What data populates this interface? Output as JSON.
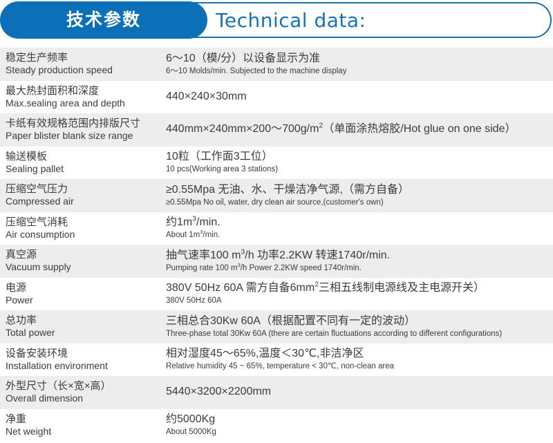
{
  "header": {
    "pill_label": "技术参数",
    "title": "Technical data:",
    "pill_color": "#0b70b8",
    "outline_color": "#1572b8",
    "title_color": "#1673b9"
  },
  "table": {
    "row_shade_gray": "#ededed",
    "row_shade_white": "#ffffff",
    "rows": [
      {
        "label_cn": "稳定生产频率",
        "label_en": "Steady production speed",
        "value_cn": "6～10（模/分）以设备显示为准",
        "value_en": "6～10 Molds/min. Subjected to the machine display"
      },
      {
        "label_cn": "最大热封面积和深度",
        "label_en": "Max.sealing area and depth",
        "value_cn": "440×240×30mm",
        "value_en": ""
      },
      {
        "label_cn": "卡纸有效规格范围内排版尺寸",
        "label_en": "Paper blister blank size range",
        "value_cn": "440mm×240mm×200～700g/m2（单面涂热熔胶/Hot glue on one side）",
        "value_en": ""
      },
      {
        "label_cn": "输送模板",
        "label_en": "Sealing pallet",
        "value_cn": "10粒（工作面3工位）",
        "value_en": "10 pcs(Working area 3 stations)"
      },
      {
        "label_cn": "压缩空气压力",
        "label_en": "Compressed air",
        "value_cn": "≥0.55Mpa  无油、水、干燥洁净气源,（需方自备）",
        "value_en": "≥0.55Mpa  No oil, water, dry clean air source,(customer's own)"
      },
      {
        "label_cn": "压缩空气消耗",
        "label_en": "Air consumption",
        "value_cn": "约1m3/min.",
        "value_en": "About 1m3/min."
      },
      {
        "label_cn": "真空源",
        "label_en": "Vacuum supply",
        "value_cn": "抽气速率100 m3/h 功率2.2KW 转速1740r/min.",
        "value_en": "Pumping rate 100 m3/h Power 2.2KW speed 1740r/min."
      },
      {
        "label_cn": "电源",
        "label_en": "Power",
        "value_cn": "380V 50Hz 60A 需方自备6mm2三相五线制电源线及主电源开关）",
        "value_en": "380V 50Hz 60A"
      },
      {
        "label_cn": "总功率",
        "label_en": "Total power",
        "value_cn": "三相总合30Kw 60A（根据配置不同有一定的波动）",
        "value_en": "Three-phase total 30Kw 60A (there are certain fluctuations according to different configurations)"
      },
      {
        "label_cn": "设备安装环境",
        "label_en": "Installation environment",
        "value_cn": "相对湿度45～65%,温度＜30℃,非洁净区",
        "value_en": "Relative humidity 45 ~ 65%, temperature < 30℃, non-clean area"
      },
      {
        "label_cn": "外型尺寸（长×宽×高）",
        "label_en": "Overall dimension",
        "value_cn": "5440×3200×2200mm",
        "value_en": ""
      },
      {
        "label_cn": "净重",
        "label_en": "Net weight",
        "value_cn": "约5000Kg",
        "value_en": "About 5000Kg"
      }
    ]
  }
}
